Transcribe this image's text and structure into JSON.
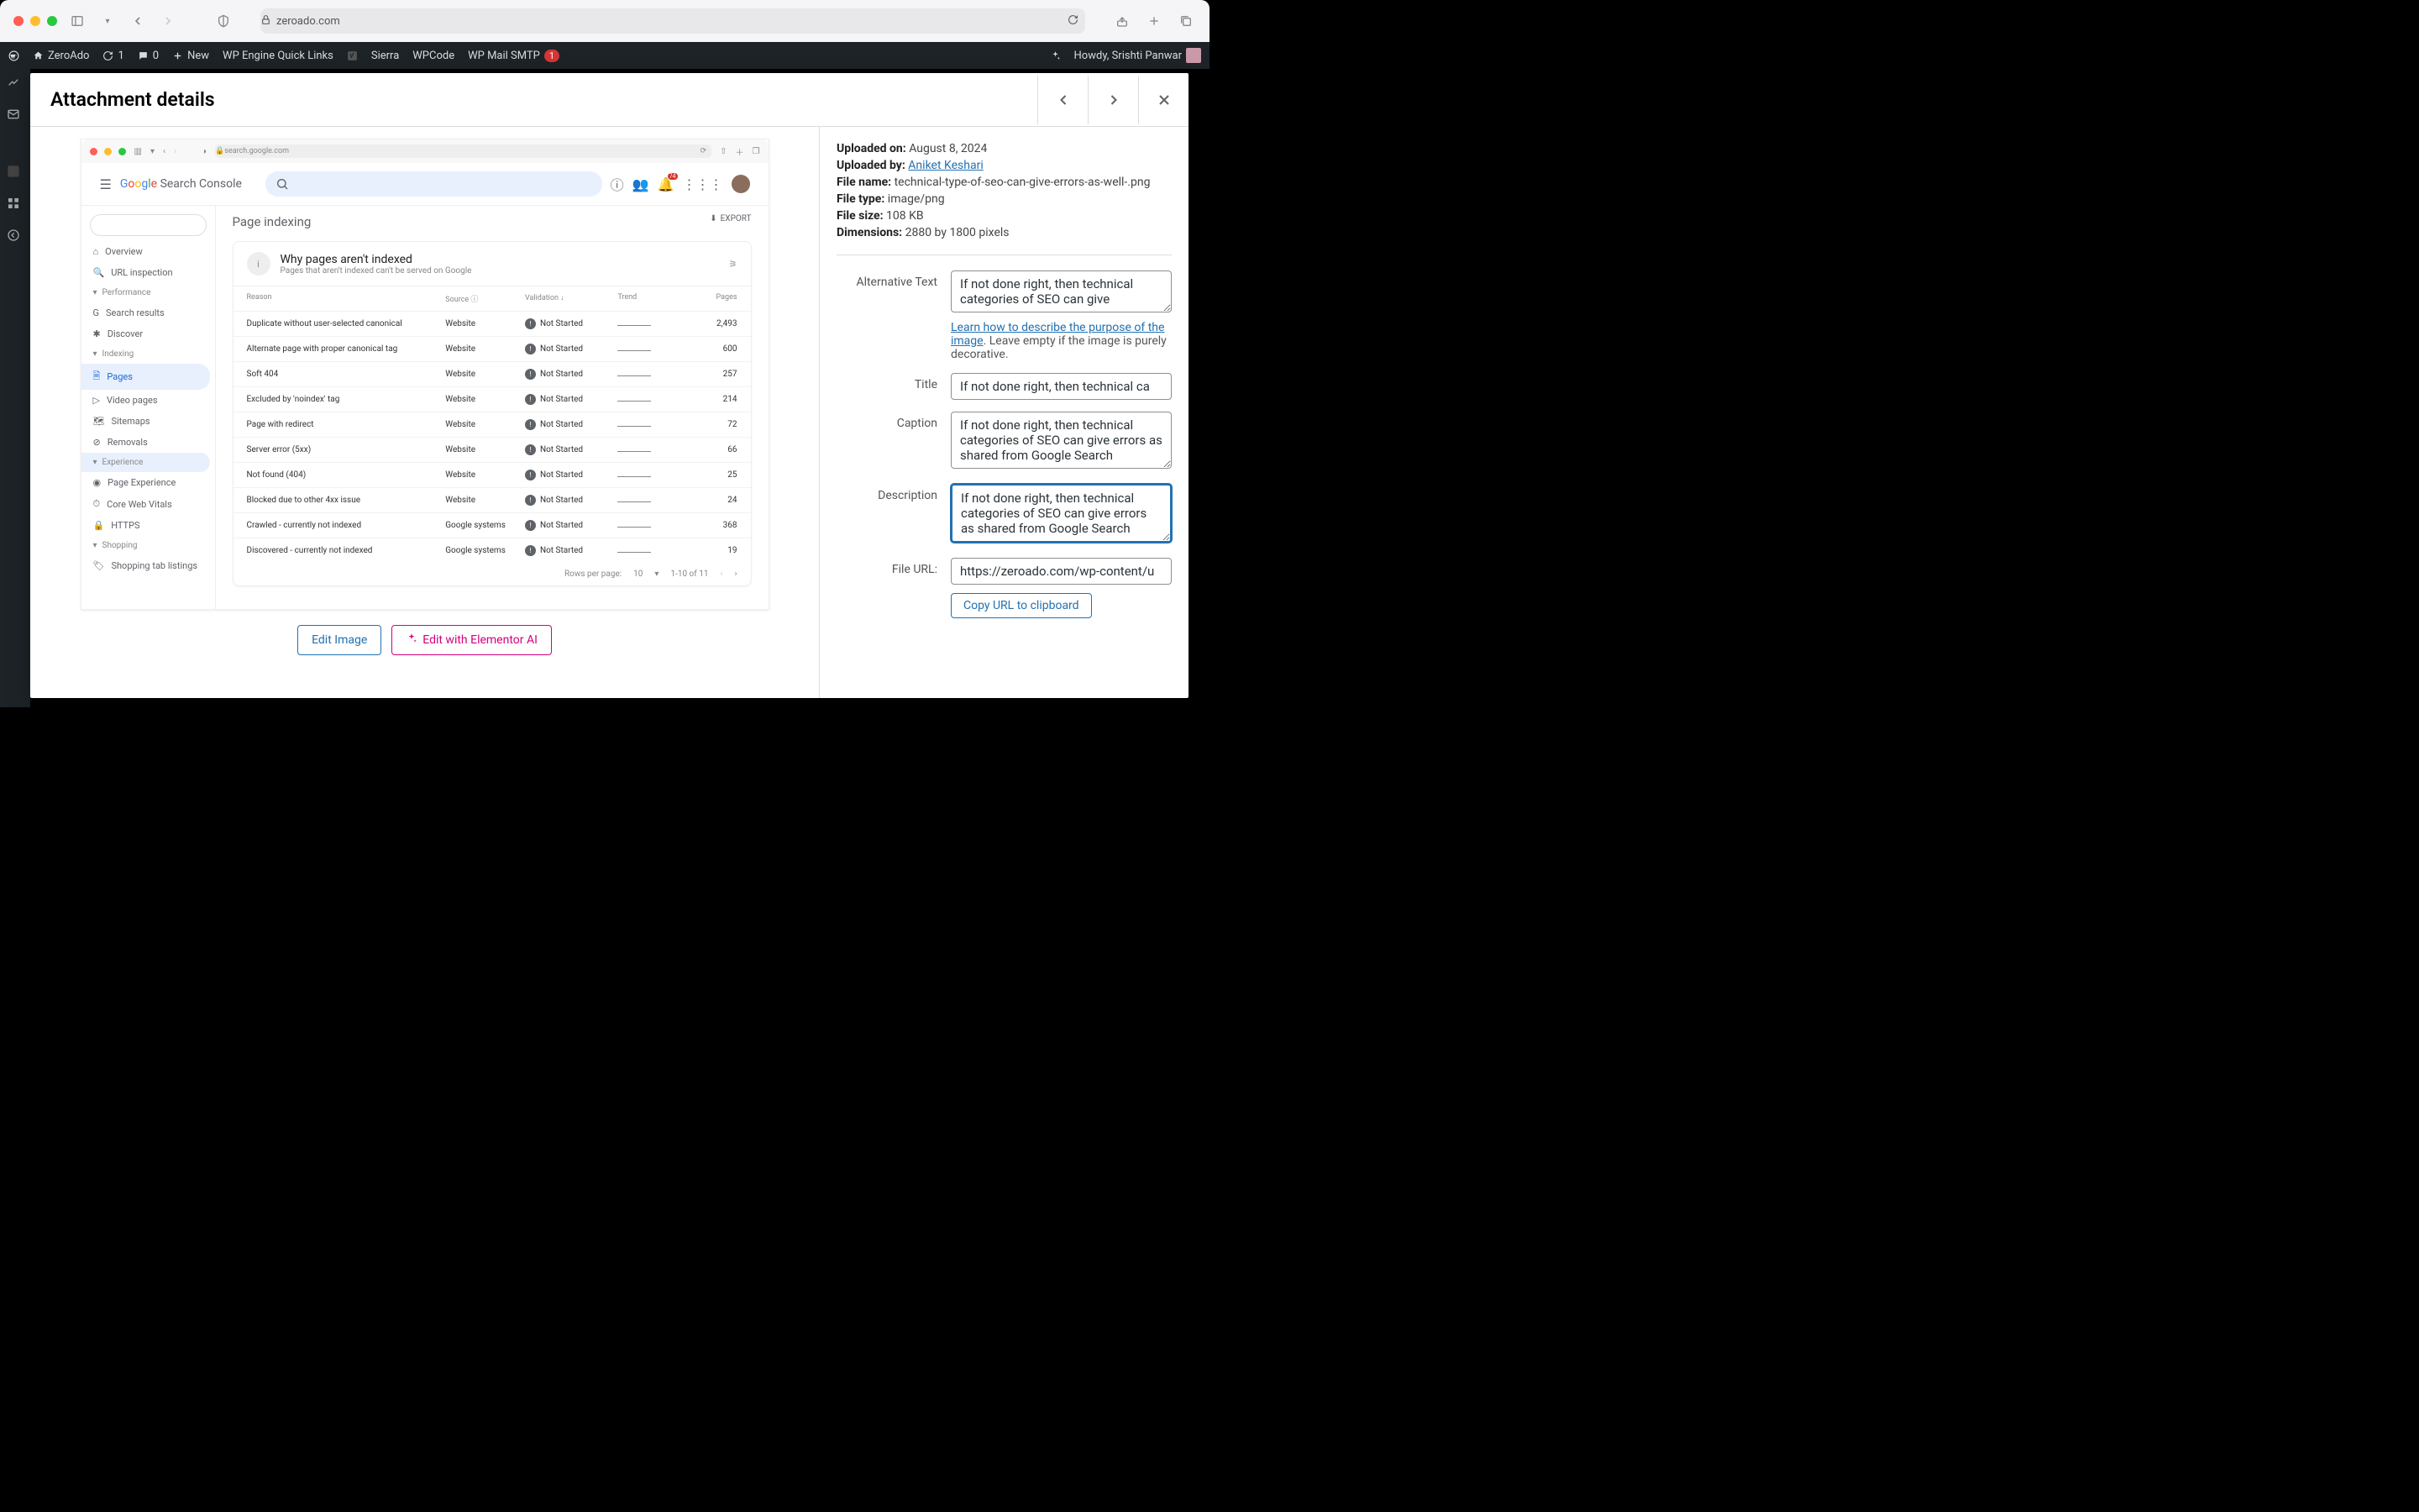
{
  "browser": {
    "url_host": "zeroado.com",
    "lock_icon": "lock-icon"
  },
  "wp_bar": {
    "site_name": "ZeroAdo",
    "updates": "1",
    "comments": "0",
    "new_label": "New",
    "quick_links": "WP Engine Quick Links",
    "sierra": "Sierra",
    "wpcode": "WPCode",
    "wp_mail": "WP Mail SMTP",
    "mail_badge": "1",
    "howdy": "Howdy, Srishti Panwar"
  },
  "modal": {
    "title": "Attachment details",
    "meta": {
      "uploaded_on_label": "Uploaded on:",
      "uploaded_on": "August 8, 2024",
      "uploaded_by_label": "Uploaded by:",
      "uploaded_by": "Aniket Keshari",
      "file_name_label": "File name:",
      "file_name": "technical-type-of-seo-can-give-errors-as-well-.png",
      "file_type_label": "File type:",
      "file_type": "image/png",
      "file_size_label": "File size:",
      "file_size": "108 KB",
      "dimensions_label": "Dimensions:",
      "dimensions": "2880 by 1800 pixels"
    },
    "fields": {
      "alt_label": "Alternative Text",
      "alt_value": "If not done right, then technical categories of SEO can give",
      "alt_help_link": "Learn how to describe the purpose of the image",
      "alt_help_rest": ". Leave empty if the image is purely decorative.",
      "title_label": "Title",
      "title_value": "If not done right, then technical ca",
      "caption_label": "Caption",
      "caption_value": "If not done right, then technical categories of SEO can give errors as shared from Google Search",
      "description_label": "Description",
      "description_value": "If not done right, then technical categories of SEO can give errors as shared from Google Search",
      "fileurl_label": "File URL:",
      "fileurl_value": "https://zeroado.com/wp-content/u",
      "copy_btn": "Copy URL to clipboard"
    },
    "edit_image": "Edit Image",
    "edit_elementor": "Edit with Elementor AI"
  },
  "gsc": {
    "mini_url": "search.google.com",
    "brand": "Search Console",
    "nav": {
      "overview": "Overview",
      "url_inspection": "URL inspection",
      "performance": "Performance",
      "search_results": "Search results",
      "discover": "Discover",
      "indexing": "Indexing",
      "pages": "Pages",
      "video_pages": "Video pages",
      "sitemaps": "Sitemaps",
      "removals": "Removals",
      "experience": "Experience",
      "page_experience": "Page Experience",
      "core_web_vitals": "Core Web Vitals",
      "https": "HTTPS",
      "shopping": "Shopping",
      "shopping_tab": "Shopping tab listings"
    },
    "page_title": "Page indexing",
    "export": "EXPORT",
    "card_title": "Why pages aren't indexed",
    "card_sub": "Pages that aren't indexed can't be served on Google",
    "cols": {
      "reason": "Reason",
      "source": "Source",
      "validation": "Validation",
      "trend": "Trend",
      "pages": "Pages"
    },
    "rows": [
      {
        "reason": "Duplicate without user-selected canonical",
        "source": "Website",
        "validation": "Not Started",
        "pages": "2,493"
      },
      {
        "reason": "Alternate page with proper canonical tag",
        "source": "Website",
        "validation": "Not Started",
        "pages": "600"
      },
      {
        "reason": "Soft 404",
        "source": "Website",
        "validation": "Not Started",
        "pages": "257"
      },
      {
        "reason": "Excluded by 'noindex' tag",
        "source": "Website",
        "validation": "Not Started",
        "pages": "214"
      },
      {
        "reason": "Page with redirect",
        "source": "Website",
        "validation": "Not Started",
        "pages": "72"
      },
      {
        "reason": "Server error (5xx)",
        "source": "Website",
        "validation": "Not Started",
        "pages": "66"
      },
      {
        "reason": "Not found (404)",
        "source": "Website",
        "validation": "Not Started",
        "pages": "25"
      },
      {
        "reason": "Blocked due to other 4xx issue",
        "source": "Website",
        "validation": "Not Started",
        "pages": "24"
      },
      {
        "reason": "Crawled - currently not indexed",
        "source": "Google systems",
        "validation": "Not Started",
        "pages": "368"
      },
      {
        "reason": "Discovered - currently not indexed",
        "source": "Google systems",
        "validation": "Not Started",
        "pages": "19"
      }
    ],
    "pager": {
      "rows_label": "Rows per page:",
      "rows_value": "10",
      "range": "1-10 of 11"
    }
  }
}
